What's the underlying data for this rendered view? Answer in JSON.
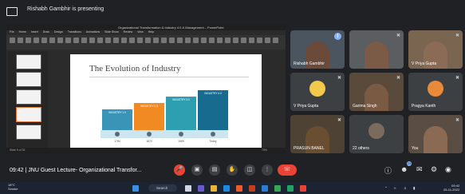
{
  "presenter": {
    "text": "Rishabh Gambhir is presenting"
  },
  "ppt": {
    "window_title": "Organizational Transformation & Industry 4.0 & Management – PowerPoint",
    "tabs": [
      "File",
      "Home",
      "Insert",
      "Draw",
      "Design",
      "Transitions",
      "Animations",
      "Slide Show",
      "Review",
      "View",
      "Help"
    ],
    "status": "Slide 5 of 32",
    "zoom": "75%"
  },
  "slide": {
    "title": "The Evolution of Industry",
    "blocks": [
      {
        "label": "INDUSTRY 1.0",
        "color": "#3a94b8"
      },
      {
        "label": "INDUSTRY 2.0",
        "color": "#f28a24"
      },
      {
        "label": "INDUSTRY 3.0",
        "color": "#2e9eb1"
      },
      {
        "label": "INDUSTRY 4.0",
        "color": "#166b8f"
      }
    ],
    "years": [
      "1784",
      "1870",
      "1969",
      "Today"
    ]
  },
  "participants": [
    {
      "name": "Rishabh Gambhir",
      "mic": "active",
      "bg": "#4a5560",
      "person": "#6b4a3a"
    },
    {
      "name": "",
      "mic": "muted",
      "bg": "#5b5e60",
      "person": "#7b5a46"
    },
    {
      "name": "V Priya Gupta",
      "mic": "muted",
      "bg": "#7a6550",
      "person": "#8b6b55"
    },
    {
      "name": "V Priya Gupta",
      "mic": "muted",
      "bg": "#3c4043",
      "avatar": "#f2c94c"
    },
    {
      "name": "Garima Singh",
      "mic": "muted",
      "bg": "#5a4a3c",
      "person": "#7a5a42"
    },
    {
      "name": "Pragya Kanth",
      "mic": "muted",
      "bg": "#3c4043",
      "avatar": "#e88a3a"
    },
    {
      "name": "PRASUN BANEL",
      "mic": "muted",
      "bg": "#4e4234",
      "person": "#6a4e32"
    },
    {
      "name": "22 others",
      "mic": "",
      "bg": "#3c4043",
      "avatar": "#7a6b5c"
    },
    {
      "name": "You",
      "mic": "muted",
      "bg": "#5a4e44",
      "person": "#8a6a52"
    }
  ],
  "meeting": {
    "time": "09:42",
    "separator": "|",
    "name": "JNU Guest Lecture- Organizational Transfor..."
  },
  "controls": [
    "mic",
    "cam",
    "cc",
    "hand",
    "present",
    "more"
  ],
  "right_controls": {
    "people_count": "23"
  },
  "taskbar": {
    "weather_temp": "18°C",
    "weather_desc": "Smoke",
    "search": "Search",
    "time": "09:42",
    "date": "25-11-2022"
  }
}
